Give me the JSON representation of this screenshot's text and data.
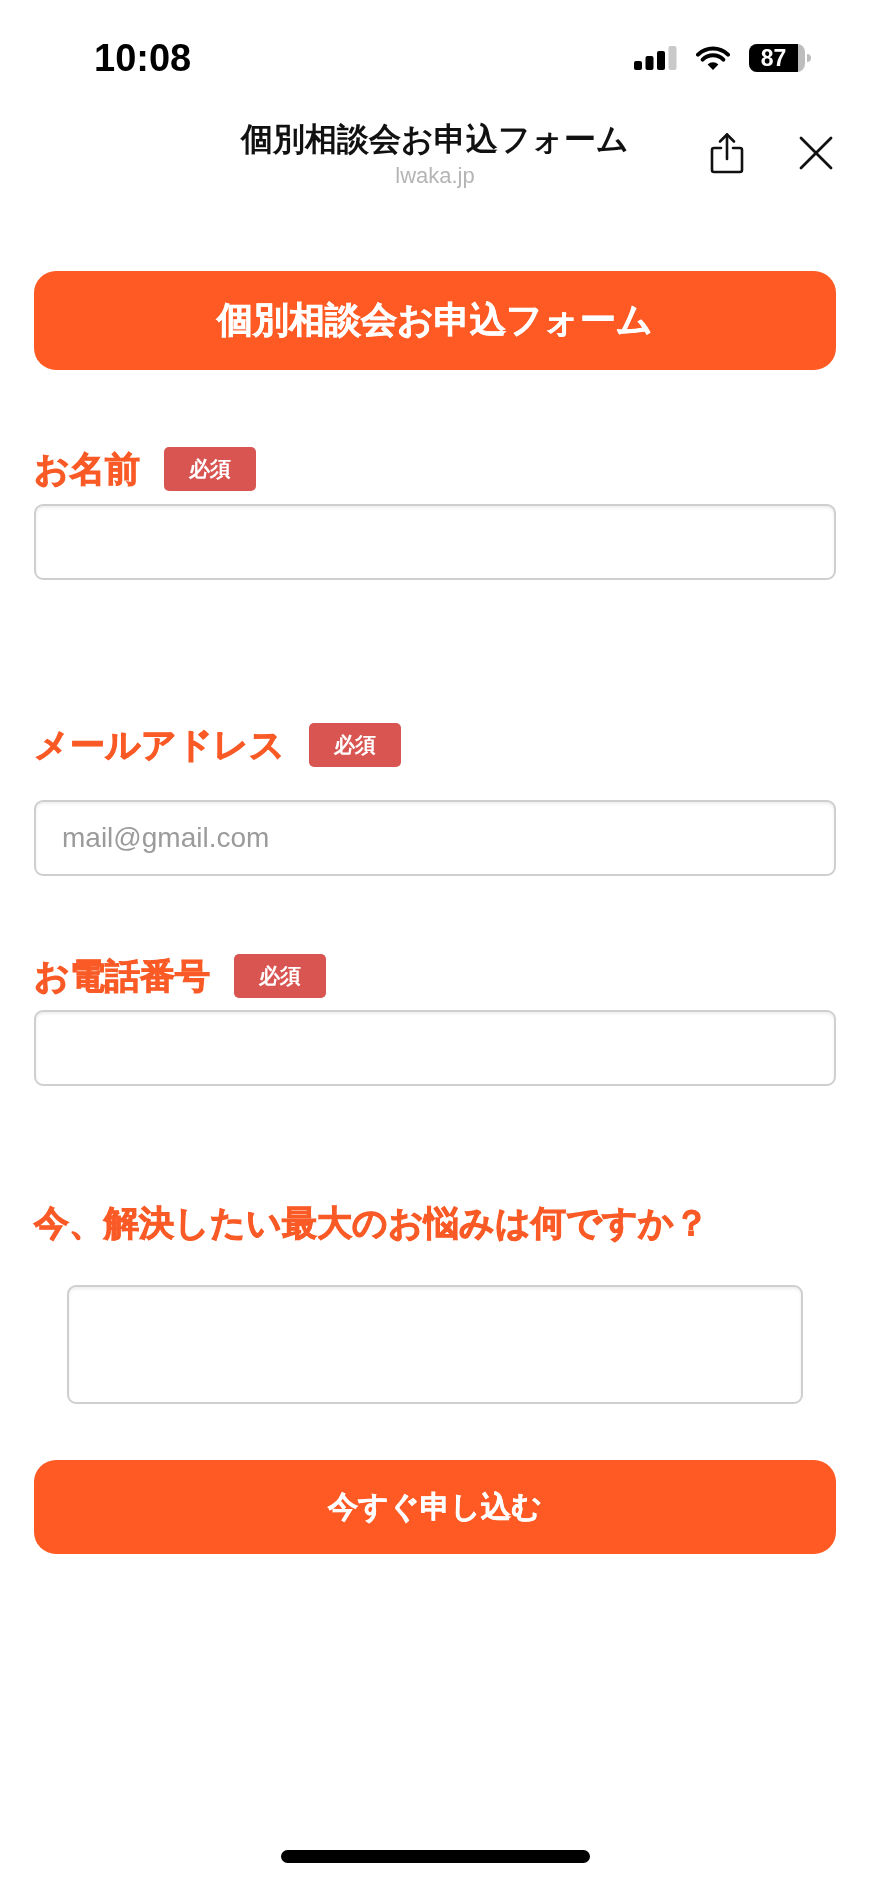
{
  "status_bar": {
    "time": "10:08",
    "battery": "87"
  },
  "header": {
    "title": "個別相談会お申込フォーム",
    "domain": "lwaka.jp"
  },
  "form": {
    "banner": "個別相談会お申込フォーム",
    "fields": [
      {
        "kind": "input",
        "label": "お名前",
        "badge": "必須"
      },
      {
        "kind": "input",
        "label": "メールアドレス",
        "badge": "必須",
        "placeholder": "mail@gmail.com"
      },
      {
        "kind": "input",
        "label": "お電話番号",
        "badge": "必須"
      },
      {
        "kind": "textarea",
        "label": "今、解決したい最大のお悩みは何ですか？"
      }
    ],
    "submit_button": "今すぐ申し込む"
  }
}
